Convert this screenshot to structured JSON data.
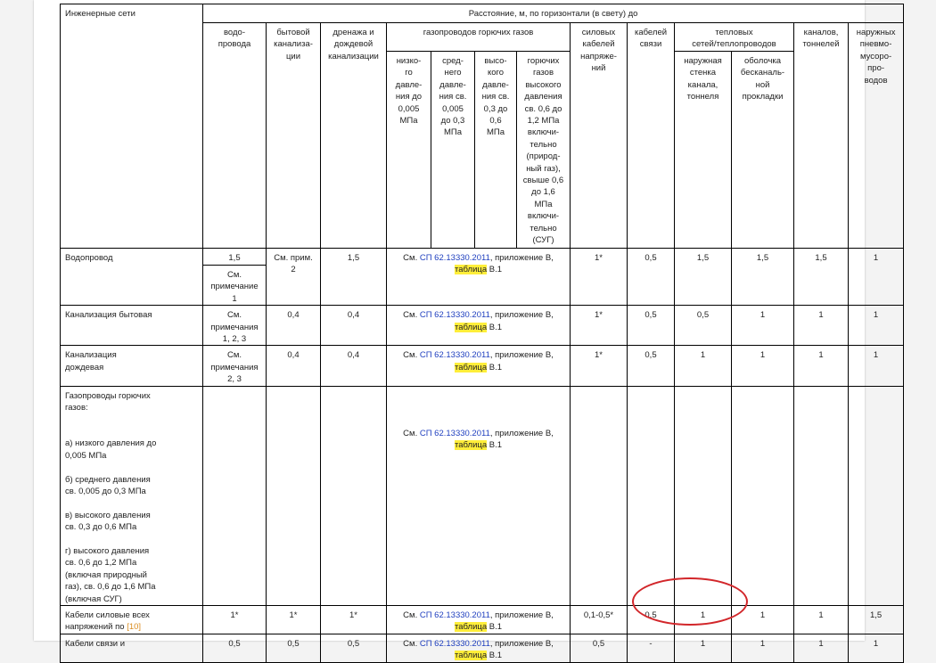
{
  "header": {
    "col_networks": "Инженерные сети",
    "distance_title": "Расстояние, м, по горизонтали (в свету) до",
    "water": "водо-\nпровода",
    "sewer_house": "бытовой\nканализа-\nции",
    "drainage": "дренажа и\nдождевой\nканализации",
    "gas_group": "газопроводов горючих газов",
    "gas_low": "низко-\nго\nдавле-\nния до\n0,005\nМПа",
    "gas_mid": "сред-\nнего\nдавле-\nния св.\n0,005\nдо 0,3\nМПа",
    "gas_high": "высо-\nкого\nдавле-\nния св.\n0,3 до\n0,6\nМПа",
    "gas_highest": "горючих\nгазов\nвысокого\nдавления\nсв. 0,6 до\n1,2 МПа\nвключи-\nтельно\n(природ-\nный газ),\nсвыше 0,6\nдо 1,6\nМПа\nвключи-\nтельно\n(СУГ)",
    "power_cables": "силовых\nкабелей\nнапряже-\nний",
    "comm_cables": "кабелей\nсвязи",
    "heat_group": "тепловых\nсетей/теплопроводов",
    "heat_outer": "наружная\nстенка\nканала,\nтоннеля",
    "heat_shell": "оболочка\nбесканаль-\nной\nпрокладки",
    "channels": "каналов,\nтоннелей",
    "pneumo": "наружных\nпневмо-\nмусоро-\nпро-\nводов"
  },
  "ref": {
    "prefix": "См. ",
    "link": "СП 62.13330.2011",
    "middle": ", приложение В,",
    "table_word": "таблица",
    "suffix": " В.1"
  },
  "rows": {
    "water": {
      "label": "Водопровод",
      "water": "1,5",
      "water_note": "См.\nпримечание\n1",
      "sewer": "См. прим.\n2",
      "drainage": "1,5",
      "power": "1*",
      "comm": "0,5",
      "heat_outer": "1,5",
      "heat_shell": "1,5",
      "channels": "1,5",
      "pneumo": "1"
    },
    "sewer": {
      "label": "Канализация бытовая",
      "water": "См.\nпримечания\n1, 2, 3",
      "sewer": "0,4",
      "drainage": "0,4",
      "power": "1*",
      "comm": "0,5",
      "heat_outer": "0,5",
      "heat_shell": "1",
      "channels": "1",
      "pneumo": "1"
    },
    "rain": {
      "label": "Канализация\nдождевая",
      "water": "См.\nпримечания\n2, 3",
      "sewer": "0,4",
      "drainage": "0,4",
      "power": "1*",
      "comm": "0,5",
      "heat_outer": "1",
      "heat_shell": "1",
      "channels": "1",
      "pneumo": "1"
    },
    "gas": {
      "label": "Газопроводы горючих\nгазов:\n\n\nа) низкого давления до\n0,005 МПа\n\nб) среднего давления\nсв. 0,005 до 0,3 МПа\n\nв) высокого давления\nсв. 0,3 до 0,6 МПа\n\nг) высокого давления\nсв. 0,6 до 1,2 МПа\n(включая природный\nгаз), св. 0,6 до 1,6 МПа\n(включая СУГ)"
    },
    "power": {
      "label": "Кабели силовые всех\nнапряжений по ",
      "label_ref": "[10]",
      "water": "1*",
      "sewer": "1*",
      "drainage": "1*",
      "power": "0,1-0,5*",
      "comm": "0,5",
      "heat_outer": "1",
      "heat_shell": "1",
      "channels": "1",
      "pneumo": "1,5"
    },
    "comm": {
      "label": "Кабели связи и",
      "water": "0,5",
      "sewer": "0,5",
      "drainage": "0,5",
      "power": "0,5",
      "comm": "-",
      "heat_outer": "1",
      "heat_shell": "1",
      "channels": "1",
      "pneumo": "1"
    }
  },
  "colors": {
    "link": "#1f3fbf",
    "highlight": "#ffee3a",
    "reference": "#d98c1f",
    "annotation_circle": "#d2262a"
  }
}
